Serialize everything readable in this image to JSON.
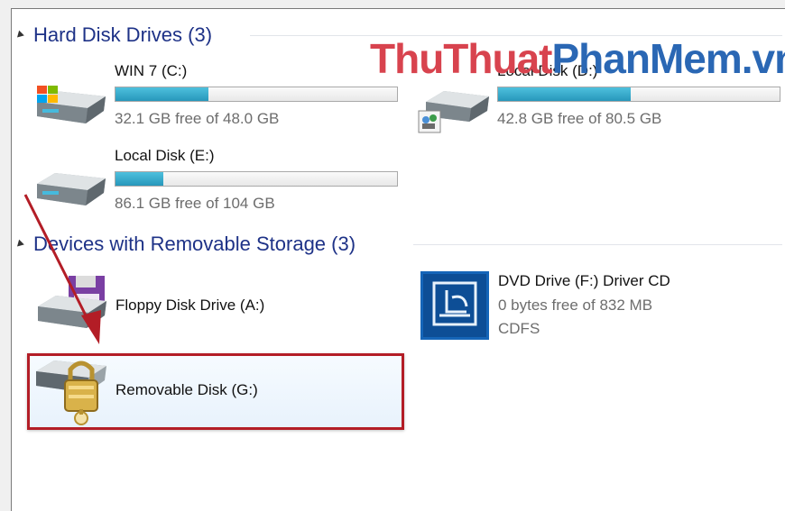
{
  "watermark": {
    "part1": "ThuThuat",
    "part2": "PhanMem.vn"
  },
  "groups": {
    "hard_disks": {
      "title": "Hard Disk Drives (3)"
    },
    "removable": {
      "title": "Devices with Removable Storage (3)"
    }
  },
  "drives": [
    {
      "name": "WIN 7 (C:)",
      "free_text": "32.1 GB free of 48.0 GB",
      "used_fraction": 0.33,
      "icon": "windows-drive-icon"
    },
    {
      "name": "Local Disk (D:)",
      "free_text": "42.8 GB free of 80.5 GB",
      "used_fraction": 0.47,
      "icon": "shared-drive-icon"
    },
    {
      "name": "Local Disk (E:)",
      "free_text": "86.1 GB free of 104 GB",
      "used_fraction": 0.17,
      "icon": "hard-drive-icon"
    }
  ],
  "devices": {
    "floppy": {
      "name": "Floppy Disk Drive (A:)",
      "icon": "floppy-drive-icon"
    },
    "dvd": {
      "name": "DVD Drive (F:) Driver CD",
      "free_text": "0 bytes free of 832 MB",
      "fs": "CDFS",
      "icon": "dvd-drive-icon"
    },
    "removable": {
      "name": "Removable Disk (G:)",
      "icon": "locked-drive-icon"
    }
  },
  "colors": {
    "accent_bar": "#2797bb",
    "header_text": "#1e3287",
    "highlight_border": "#b31d26",
    "arrow": "#b31d26"
  }
}
